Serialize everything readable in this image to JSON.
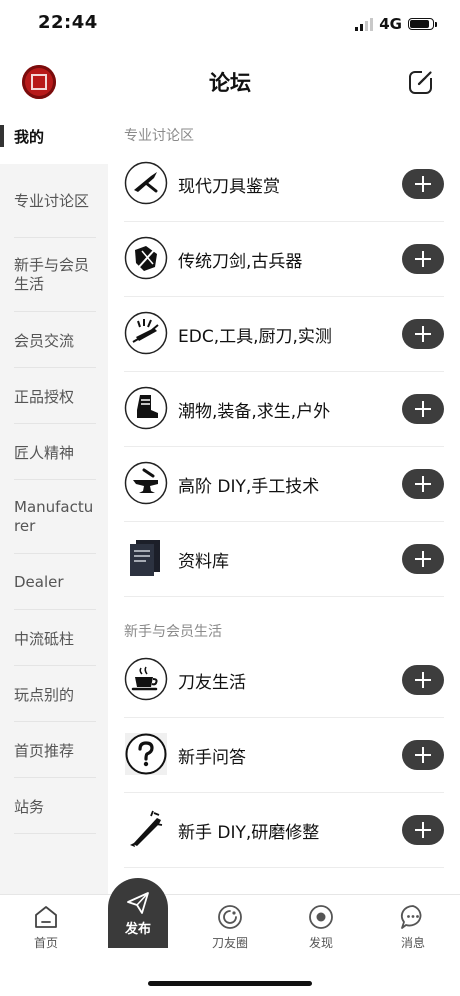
{
  "status_bar": {
    "time": "22:44",
    "network": "4G"
  },
  "header": {
    "title": "论坛",
    "avatar_icon": "seal-avatar-icon",
    "edit_icon": "edit-square-icon"
  },
  "sidebar": {
    "items": [
      {
        "label": "我的",
        "active": true
      },
      {
        "label": "专业讨论区"
      },
      {
        "label": "新手与会员生活"
      },
      {
        "label": "会员交流"
      },
      {
        "label": "正品授权"
      },
      {
        "label": "匠人精神"
      },
      {
        "label": "Manufacturer"
      },
      {
        "label": "Dealer"
      },
      {
        "label": "中流砥柱"
      },
      {
        "label": "玩点别的"
      },
      {
        "label": "首页推荐"
      },
      {
        "label": "站务"
      }
    ]
  },
  "sections": [
    {
      "title": "专业讨论区",
      "forums": [
        {
          "label": "现代刀具鉴赏",
          "icon": "folding-knife-icon"
        },
        {
          "label": "传统刀剑,古兵器",
          "icon": "traditional-sword-icon"
        },
        {
          "label": "EDC,工具,厨刀,实测",
          "icon": "multitool-icon"
        },
        {
          "label": "潮物,装备,求生,户外",
          "icon": "boot-icon"
        },
        {
          "label": "高阶 DIY,手工技术",
          "icon": "anvil-icon"
        },
        {
          "label": "资料库",
          "icon": "archive-book-icon"
        }
      ]
    },
    {
      "title": "新手与会员生活",
      "forums": [
        {
          "label": "刀友生活",
          "icon": "coffee-cup-icon"
        },
        {
          "label": "新手问答",
          "icon": "question-icon"
        },
        {
          "label": "新手 DIY,研磨修整",
          "icon": "grinding-tool-icon"
        }
      ]
    }
  ],
  "tabbar": {
    "home": "首页",
    "publish": "发布",
    "circle": "刀友圈",
    "discover": "发现",
    "messages": "消息"
  }
}
